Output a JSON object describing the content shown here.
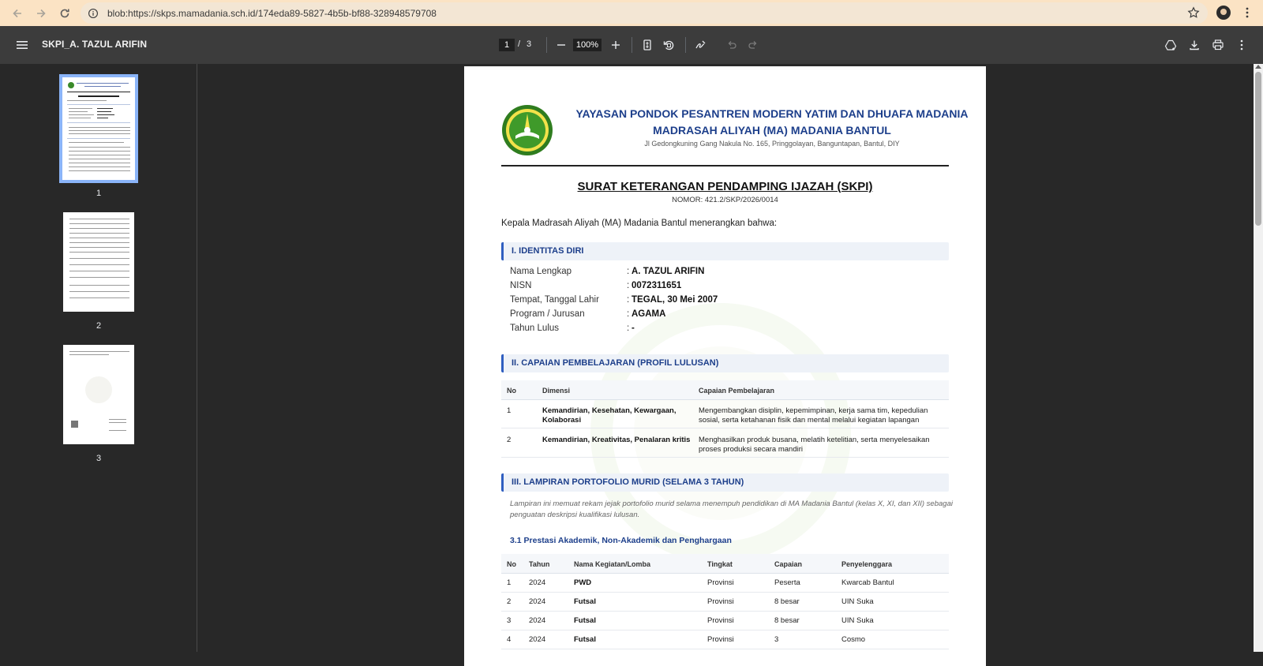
{
  "browser": {
    "url": "blob:https://skps.mamadania.sch.id/174eda89-5827-4b5b-bf88-328948579708"
  },
  "toolbar": {
    "doc_title": "SKPI_A. TAZUL ARIFIN",
    "page_current": "1",
    "page_sep": "/",
    "page_total": "3",
    "zoom": "100%"
  },
  "thumbnails": [
    {
      "num": "1"
    },
    {
      "num": "2"
    },
    {
      "num": "3"
    }
  ],
  "doc": {
    "header_line1": "YAYASAN PONDOK PESANTREN MODERN YATIM DAN DHUAFA MADANIA",
    "header_line2": "MADRASAH ALIYAH (MA) MADANIA BANTUL",
    "header_address": "Jl Gedongkuning Gang Nakula No. 165, Pringgolayan, Banguntapan, Bantul, DIY",
    "title": "SURAT KETERANGAN PENDAMPING IJAZAH (SKPI)",
    "nomor": "NOMOR: 421.2/SKP/2026/0014",
    "intro": "Kepala Madrasah Aliyah (MA) Madania Bantul menerangkan bahwa:",
    "section1": "I. IDENTITAS DIRI",
    "identity": [
      {
        "label": "Nama Lengkap",
        "colon": ":",
        "value": "A. TAZUL ARIFIN"
      },
      {
        "label": "NISN",
        "colon": ":",
        "value": "0072311651"
      },
      {
        "label": "Tempat, Tanggal Lahir",
        "colon": ":",
        "value": "TEGAL, 30 Mei 2007"
      },
      {
        "label": "Program / Jurusan",
        "colon": ":",
        "value": "AGAMA"
      },
      {
        "label": "Tahun Lulus",
        "colon": ":",
        "value": "-"
      }
    ],
    "section2": "II. CAPAIAN PEMBELAJARAN (PROFIL LULUSAN)",
    "capaian_headers": {
      "no": "No",
      "dimensi": "Dimensi",
      "capaian": "Capaian Pembelajaran"
    },
    "capaian_rows": [
      {
        "no": "1",
        "dimensi_1": "Kemandirian, Kesehatan, Kewargaan,",
        "dimensi_2": "Kolaborasi",
        "capaian_1": "Mengembangkan disiplin, kepemimpinan, kerja sama tim, kepedulian",
        "capaian_2": "sosial, serta ketahanan fisik dan mental melalui kegiatan lapangan"
      },
      {
        "no": "2",
        "dimensi_1": "Kemandirian, Kreativitas, Penalaran kritis",
        "dimensi_2": "",
        "capaian_1": "Menghasilkan produk busana, melatih ketelitian, serta menyelesaikan",
        "capaian_2": "proses produksi secara mandiri"
      }
    ],
    "section3": "III. LAMPIRAN PORTOFOLIO MURID (SELAMA 3 TAHUN)",
    "note_1": "Lampiran ini memuat rekam jejak portofolio murid selama menempuh pendidikan di MA Madania Bantul (kelas X, XI, dan XII) sebagai",
    "note_2": "penguatan deskripsi kualifikasi lulusan.",
    "subsection": "3.1 Prestasi Akademik, Non-Akademik dan Penghargaan",
    "prestasi_headers": {
      "no": "No",
      "tahun": "Tahun",
      "nama": "Nama Kegiatan/Lomba",
      "tingkat": "Tingkat",
      "capaian": "Capaian",
      "penyelenggara": "Penyelenggara"
    },
    "prestasi_rows": [
      {
        "no": "1",
        "tahun": "2024",
        "nama": "PWD",
        "tingkat": "Provinsi",
        "capaian": "Peserta",
        "penyelenggara": "Kwarcab Bantul"
      },
      {
        "no": "2",
        "tahun": "2024",
        "nama": "Futsal",
        "tingkat": "Provinsi",
        "capaian": "8 besar",
        "penyelenggara": "UIN Suka"
      },
      {
        "no": "3",
        "tahun": "2024",
        "nama": "Futsal",
        "tingkat": "Provinsi",
        "capaian": "8 besar",
        "penyelenggara": "UIN Suka"
      },
      {
        "no": "4",
        "tahun": "2024",
        "nama": "Futsal",
        "tingkat": "Provinsi",
        "capaian": "3",
        "penyelenggara": "Cosmo"
      }
    ]
  },
  "colors": {
    "browser_bar": "#fbe3c4",
    "toolbar": "#3c3c3c",
    "heading_blue": "#1d3f8b",
    "section_accent": "#2f5ec0",
    "thumb_selected": "#8ab4f8"
  }
}
